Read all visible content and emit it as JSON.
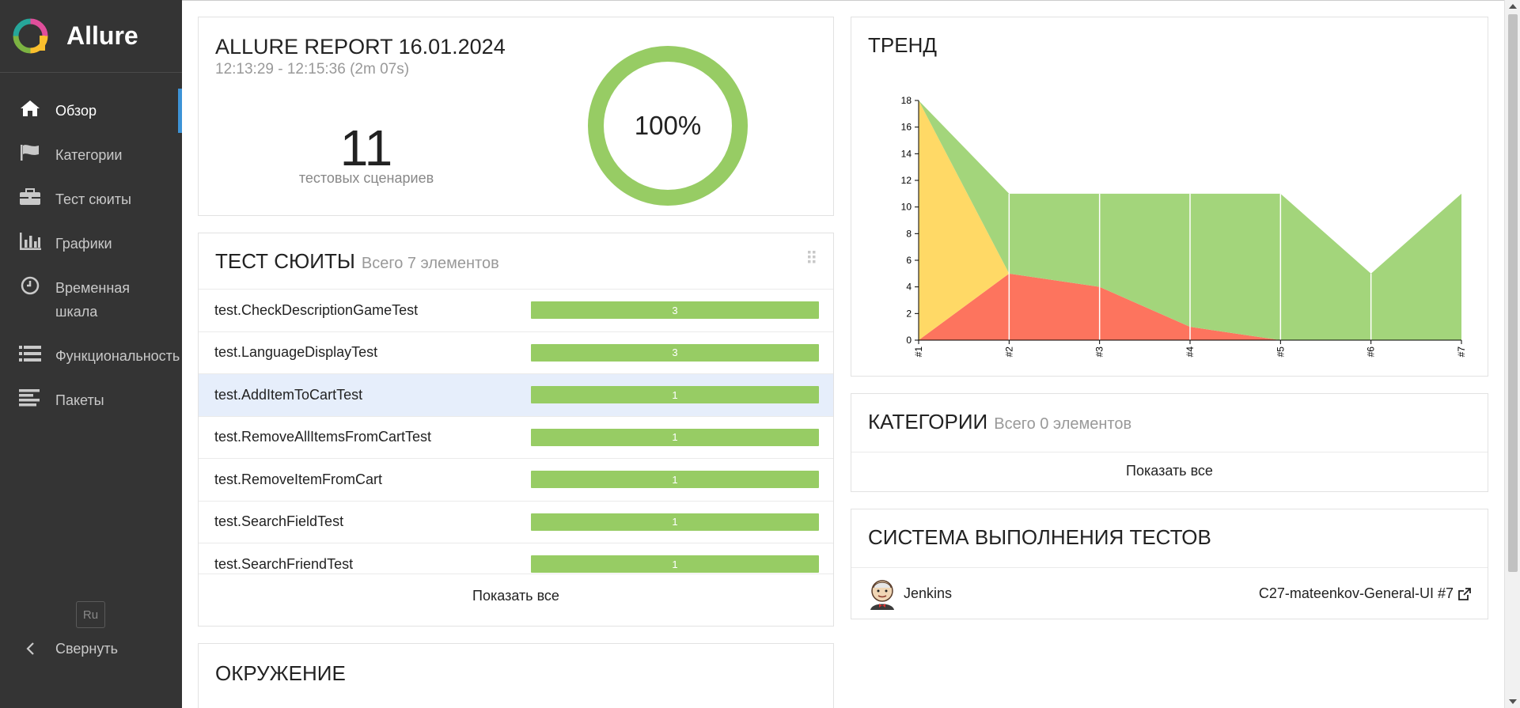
{
  "app": {
    "name": "Allure"
  },
  "sidebar": {
    "items": [
      {
        "label": "Обзор",
        "icon": "home-icon"
      },
      {
        "label": "Категории",
        "icon": "flag-icon"
      },
      {
        "label": "Тест сюиты",
        "icon": "briefcase-icon"
      },
      {
        "label": "Графики",
        "icon": "bar-chart-icon"
      },
      {
        "label": "Временная шкала",
        "icon": "clock-icon"
      },
      {
        "label": "Функциональность",
        "icon": "list-icon"
      },
      {
        "label": "Пакеты",
        "icon": "align-left-icon"
      }
    ],
    "lang": "Ru",
    "collapse": "Свернуть"
  },
  "summary": {
    "title": "ALLURE REPORT 16.01.2024",
    "time": "12:13:29 - 12:15:36 (2m 07s)",
    "count": "11",
    "count_label": "тестовых сценариев",
    "percent": "100%",
    "passed_fraction": 1.0
  },
  "suites": {
    "title": "ТЕСТ СЮИТЫ",
    "subtitle": "Всего 7 элементов",
    "rows": [
      {
        "name": "test.CheckDescriptionGameTest",
        "count": "3"
      },
      {
        "name": "test.LanguageDisplayTest",
        "count": "3"
      },
      {
        "name": "test.AddItemToCartTest",
        "count": "1"
      },
      {
        "name": "test.RemoveAllItemsFromCartTest",
        "count": "1"
      },
      {
        "name": "test.RemoveItemFromCart",
        "count": "1"
      },
      {
        "name": "test.SearchFieldTest",
        "count": "1"
      },
      {
        "name": "test.SearchFriendTest",
        "count": "1"
      }
    ],
    "show_all": "Показать все"
  },
  "environment": {
    "title": "ОКРУЖЕНИЕ"
  },
  "trend": {
    "title": "ТРЕНД"
  },
  "chart_data": {
    "type": "area",
    "title": "ТРЕНД",
    "x": [
      "#1",
      "#2",
      "#3",
      "#4",
      "#5",
      "#6",
      "#7"
    ],
    "yticks": [
      "0",
      "2",
      "4",
      "6",
      "8",
      "10",
      "12",
      "14",
      "16",
      "18"
    ],
    "ylim": [
      0,
      18
    ],
    "series": [
      {
        "values": [
          0,
          5,
          4,
          1,
          0,
          0,
          0
        ],
        "color": "#fd745e"
      },
      {
        "values": [
          18,
          0,
          0,
          0,
          0,
          0,
          0
        ],
        "color": "#ffd966"
      },
      {
        "values": [
          0,
          6,
          7,
          10,
          11,
          5,
          11
        ],
        "color": "#a3d57b"
      }
    ]
  },
  "categories": {
    "title": "КАТЕГОРИИ",
    "subtitle": "Всего 0 элементов",
    "show_all": "Показать все"
  },
  "executors": {
    "title": "СИСТЕМА ВЫПОЛНЕНИЯ ТЕСТОВ",
    "name": "Jenkins",
    "build": "C27-mateenkov-General-UI #7"
  },
  "colors": {
    "passed": "#97cc64",
    "failed": "#fd5a3e",
    "broken": "#ffd050",
    "sidebar": "#343434",
    "accent": "#3d93d6"
  }
}
